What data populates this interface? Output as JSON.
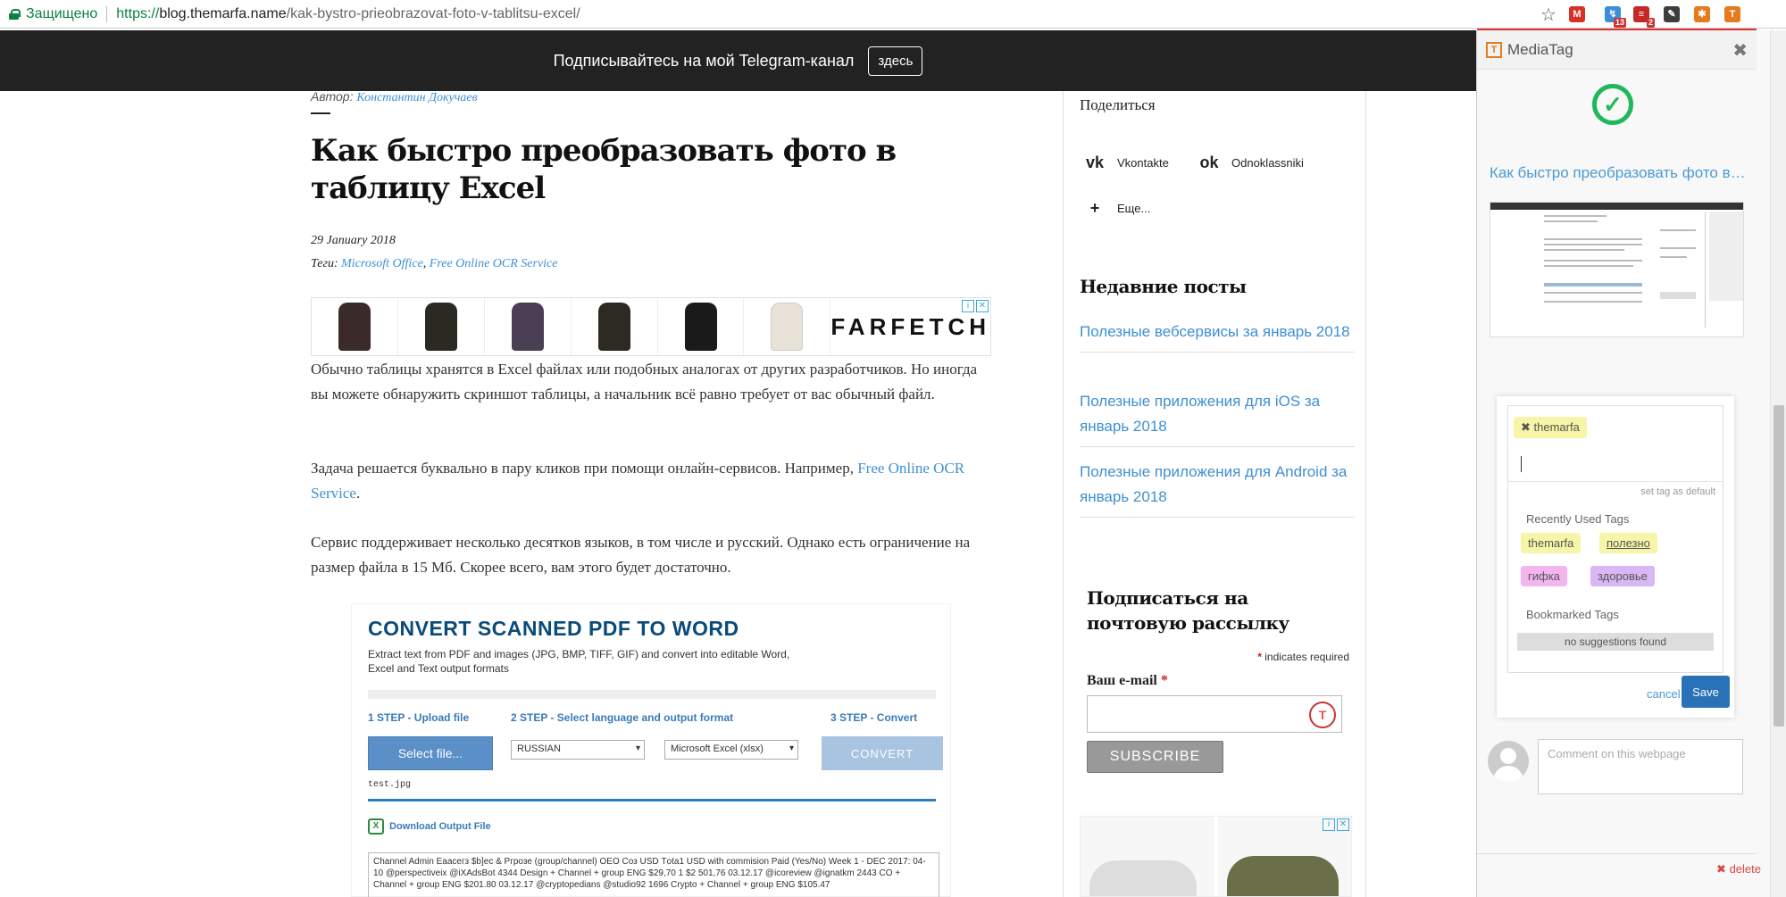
{
  "browser": {
    "secure_label": "Защищено",
    "url_proto": "https://",
    "url_host": "blog.themarfa.name",
    "url_path": "/kak-bystro-prieobrazovat-foto-v-tablitsu-excel/",
    "extensions": [
      {
        "name": "gmail-icon",
        "glyph": "M",
        "color": "#d93025",
        "badge": ""
      },
      {
        "name": "extension-arrows-icon",
        "glyph": "↯",
        "color": "#3b8fd6",
        "badge": "13"
      },
      {
        "name": "extension-stack-icon",
        "glyph": "≡",
        "color": "#c62828",
        "badge": "2"
      },
      {
        "name": "evernote-icon",
        "glyph": "✎",
        "color": "#3d3d3d",
        "badge": ""
      },
      {
        "name": "extension-fox-icon",
        "glyph": "✱",
        "color": "#e67a1f",
        "badge": ""
      },
      {
        "name": "mediatag-extension-icon",
        "glyph": "T",
        "color": "#e67a1f",
        "badge": ""
      }
    ]
  },
  "telegram_bar": {
    "text": "Подписывайтесь на мой Telegram-канал",
    "button": "здесь"
  },
  "article": {
    "author_label": "Автор:",
    "author_name": "Константин Докучаев",
    "title": "Как быстро преобразовать фото в таблицу Excel",
    "date": "29 January 2018",
    "tags_label": "Теги:",
    "tag1": "Microsoft Office",
    "tag_sep": ",",
    "tag2": "Free Online OCR Service",
    "para1": "Обычно таблицы хранятся в Excel файлах или подобных аналогах от других разработчиков. Но иногда вы можете обнаружить скриншот таблицы, а начальник всё равно требует от вас обычный файл.",
    "para2_text": "Задача решается буквально в пару кликов при помощи онлайн-сервисов. Например,",
    "para2_link": "Free Online OCR Service",
    "para2_end": ".",
    "para3": "Сервис поддерживает несколько десятков языков, в том числе и русский. Однако есть ограничение на размер файла в 15 Мб. Скорее всего, вам этого будет достаточно."
  },
  "ad": {
    "brand": "FARFETCH",
    "coat_colors": [
      "#3a2a2a",
      "#2a2a22",
      "#4a3f55",
      "#2d2a22",
      "#1a1a1a",
      "#e8e2d8"
    ]
  },
  "ocr": {
    "title": "CONVERT SCANNED PDF TO WORD",
    "desc": "Extract text from PDF and images (JPG, BMP, TIFF, GIF) and convert into editable Word, Excel and Text output formats",
    "step1": "1 STEP - Upload file",
    "step2": "2 STEP - Select language and output format",
    "step3": "3 STEP - Convert",
    "select_file": "Select file...",
    "language": "RUSSIAN",
    "format": "Microsoft Excel (xlsx)",
    "convert": "CONVERT",
    "file_name": "test.jpg",
    "download": "Download Output File",
    "output": "Channel Admin Еаасегз $b]ес & Ргрозе (group/channel) OEO Соз USD Тota1 USD with commision Paid (Yes/No) Week 1 - DEC 2017: 04-10 @perspectiveix @iXAdsBot 4344 Design + Channel + group ENG $29,70 1 $2 501,76 03.12.17 @icoreview @ignatkm 2443 CO + Channel + group ENG $201.80 03.12.17 @cryptopedians @studio92 1696 Crypto + Channel + group ENG $105.47"
  },
  "sidebar": {
    "share_title": "Поделиться",
    "vk": "Vkontakte",
    "ok": "Odnoklassniki",
    "more": "Еще...",
    "recent_title": "Недавние посты",
    "posts": [
      "Полезные вебсервисы за январь 2018",
      "Полезные приложения для iOS за январь 2018",
      "Полезные приложения для Android за январь 2018"
    ],
    "subscribe_title": "Подписаться на почтовую рассылку",
    "required_mark": "*",
    "required_text": "indicates required",
    "email_label": "Ваш e-mail",
    "subscribe_btn": "SUBSCRIBE"
  },
  "mediatag": {
    "name": "MediaTag",
    "page_link": "Как быстро преобразовать фото в таблицу Excel",
    "selected_tag": "themarfa",
    "set_default": "set tag as default",
    "recent_label": "Recently Used Tags",
    "recent_tags": [
      "themarfa",
      "полезно",
      "гифка",
      "здоровье"
    ],
    "bookmarked_label": "Bookmarked Tags",
    "no_suggestions": "no suggestions found",
    "cancel": "cancel",
    "save": "Save",
    "comment_placeholder": "Comment on this webpage",
    "delete": "delete"
  }
}
